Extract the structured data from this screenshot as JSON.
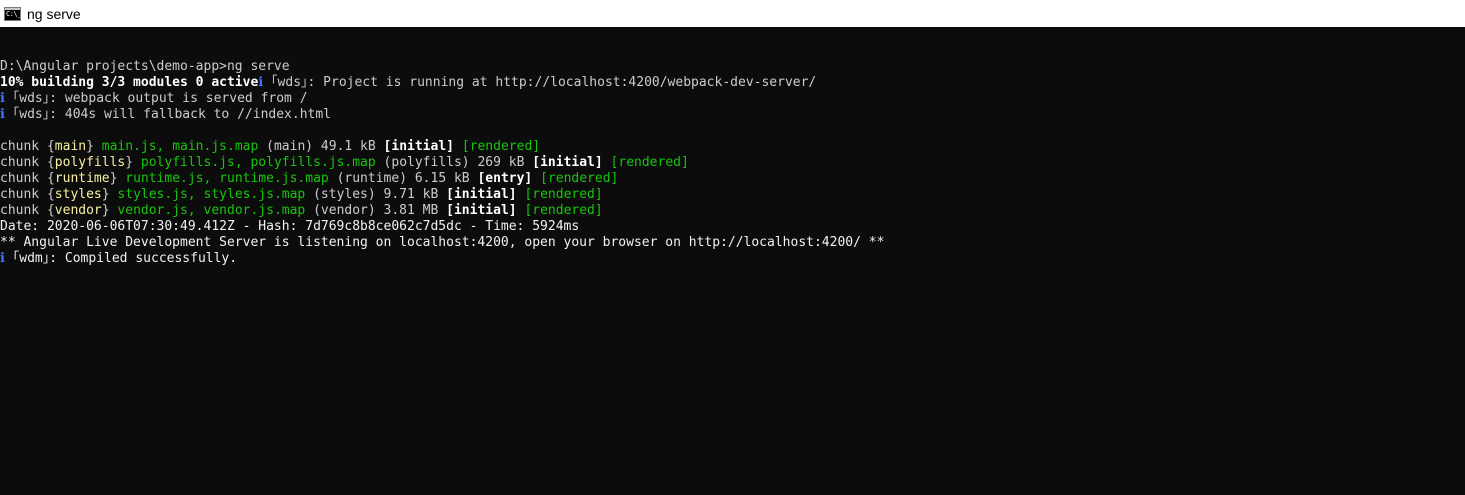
{
  "window": {
    "title": "ng serve",
    "icon_name": "cmd-icon",
    "icon_text": "C:\\_"
  },
  "console": {
    "lines": [
      {
        "segments": []
      },
      {
        "segments": [
          {
            "text": "D:\\Angular projects\\demo-app>ng serve",
            "style": "gray"
          }
        ]
      },
      {
        "segments": [
          {
            "text": "10% building 3/3 modules 0 active",
            "style": "bold"
          },
          {
            "text": "ℹ ",
            "style": "blue"
          },
          {
            "text": "｢wds｣: Project is running at http://localhost:4200/webpack-dev-server/",
            "style": "gray"
          }
        ]
      },
      {
        "segments": [
          {
            "text": "ℹ ",
            "style": "blue"
          },
          {
            "text": "｢wds｣: webpack output is served from /",
            "style": "gray"
          }
        ]
      },
      {
        "segments": [
          {
            "text": "ℹ ",
            "style": "blue"
          },
          {
            "text": "｢wds｣: 404s will fallback to //index.html",
            "style": "gray"
          }
        ]
      },
      {
        "segments": []
      },
      {
        "segments": [
          {
            "text": "chunk {",
            "style": "gray"
          },
          {
            "text": "main",
            "style": "yellow"
          },
          {
            "text": "} ",
            "style": "gray"
          },
          {
            "text": "main.js, main.js.map",
            "style": "green"
          },
          {
            "text": " (main) 49.1 kB ",
            "style": "gray"
          },
          {
            "text": "[initial]",
            "style": "bold"
          },
          {
            "text": " ",
            "style": "gray"
          },
          {
            "text": "[rendered]",
            "style": "green"
          }
        ]
      },
      {
        "segments": [
          {
            "text": "chunk {",
            "style": "gray"
          },
          {
            "text": "polyfills",
            "style": "yellow"
          },
          {
            "text": "} ",
            "style": "gray"
          },
          {
            "text": "polyfills.js, polyfills.js.map",
            "style": "green"
          },
          {
            "text": " (polyfills) 269 kB ",
            "style": "gray"
          },
          {
            "text": "[initial]",
            "style": "bold"
          },
          {
            "text": " ",
            "style": "gray"
          },
          {
            "text": "[rendered]",
            "style": "green"
          }
        ]
      },
      {
        "segments": [
          {
            "text": "chunk {",
            "style": "gray"
          },
          {
            "text": "runtime",
            "style": "yellow"
          },
          {
            "text": "} ",
            "style": "gray"
          },
          {
            "text": "runtime.js, runtime.js.map",
            "style": "green"
          },
          {
            "text": " (runtime) 6.15 kB ",
            "style": "gray"
          },
          {
            "text": "[entry]",
            "style": "bold"
          },
          {
            "text": " ",
            "style": "gray"
          },
          {
            "text": "[rendered]",
            "style": "green"
          }
        ]
      },
      {
        "segments": [
          {
            "text": "chunk {",
            "style": "gray"
          },
          {
            "text": "styles",
            "style": "yellow"
          },
          {
            "text": "} ",
            "style": "gray"
          },
          {
            "text": "styles.js, styles.js.map",
            "style": "green"
          },
          {
            "text": " (styles) 9.71 kB ",
            "style": "gray"
          },
          {
            "text": "[initial]",
            "style": "bold"
          },
          {
            "text": " ",
            "style": "gray"
          },
          {
            "text": "[rendered]",
            "style": "green"
          }
        ]
      },
      {
        "segments": [
          {
            "text": "chunk {",
            "style": "gray"
          },
          {
            "text": "vendor",
            "style": "yellow"
          },
          {
            "text": "} ",
            "style": "gray"
          },
          {
            "text": "vendor.js, vendor.js.map",
            "style": "green"
          },
          {
            "text": " (vendor) 3.81 MB ",
            "style": "gray"
          },
          {
            "text": "[initial]",
            "style": "bold"
          },
          {
            "text": " ",
            "style": "gray"
          },
          {
            "text": "[rendered]",
            "style": "green"
          }
        ]
      },
      {
        "segments": [
          {
            "text": "Date: 2020-06-06T07:30:49.412Z - Hash: 7d769c8b8ce062c7d5dc - Time: 5924ms",
            "style": "white"
          }
        ]
      },
      {
        "segments": [
          {
            "text": "** Angular Live Development Server is listening on localhost:4200, open your browser on http://localhost:4200/ **",
            "style": "white"
          }
        ]
      },
      {
        "segments": [
          {
            "text": "ℹ ",
            "style": "blue"
          },
          {
            "text": "｢wdm｣: Compiled successfully.",
            "style": "white"
          }
        ]
      }
    ]
  },
  "colors": {
    "background": "#0c0c0c",
    "titlebar": "#ffffff",
    "text": "#cccccc",
    "green": "#16c60c",
    "yellow": "#f9f1a5",
    "blue": "#3b78ff"
  }
}
